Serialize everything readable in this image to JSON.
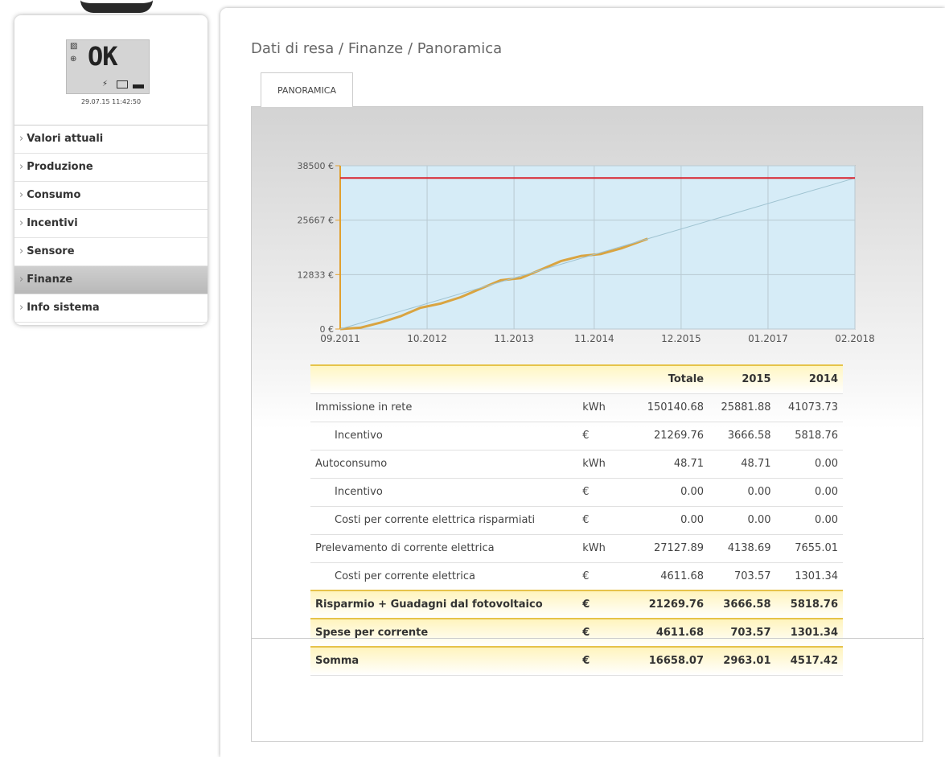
{
  "device": {
    "lcd_text": "OK",
    "datetime": "29.07.15 11:42:50"
  },
  "nav": [
    {
      "label": "Valori attuali",
      "active": false
    },
    {
      "label": "Produzione",
      "active": false
    },
    {
      "label": "Consumo",
      "active": false
    },
    {
      "label": "Incentivi",
      "active": false
    },
    {
      "label": "Sensore",
      "active": false
    },
    {
      "label": "Finanze",
      "active": true
    },
    {
      "label": "Info sistema",
      "active": false
    }
  ],
  "nav_caret": "›",
  "breadcrumb": "Dati di resa / Finanze / Panoramica",
  "tab_label": "PANORAMICA",
  "chart_data": {
    "type": "line",
    "ylim": [
      0,
      38500
    ],
    "y_ticks": [
      "0 €",
      "12833 €",
      "25667 €",
      "38500 €"
    ],
    "x_ticks": [
      "09.2011",
      "10.2012",
      "11.2013",
      "11.2014",
      "12.2015",
      "01.2017",
      "02.2018"
    ],
    "grid": true,
    "series": [
      {
        "color": "#d9a441",
        "x": [
          "09.2011",
          "12.2011",
          "03.2012",
          "06.2012",
          "09.2012",
          "12.2012",
          "03.2013",
          "06.2013",
          "09.2013",
          "12.2013",
          "03.2014",
          "06.2014",
          "09.2014",
          "12.2014",
          "03.2015",
          "07.2015"
        ],
        "values": [
          0,
          300,
          1500,
          3000,
          5000,
          6000,
          7500,
          9500,
          11500,
          12000,
          14000,
          16000,
          17200,
          17700,
          19000,
          21270
        ]
      },
      {
        "color": "#9fc3d1",
        "x": [
          "09.2011",
          "02.2018"
        ],
        "values": [
          0,
          35600
        ]
      },
      {
        "color": "#d9232e",
        "x": [
          "09.2011",
          "02.2018"
        ],
        "values": [
          35600,
          35600
        ]
      }
    ]
  },
  "table": {
    "headers": [
      "",
      "",
      "Totale",
      "2015",
      "2014"
    ],
    "rows": [
      {
        "label": "Immissione in rete",
        "unit": "kWh",
        "total": "150140.68",
        "y2015": "25881.88",
        "y2014": "41073.73",
        "indent": false
      },
      {
        "label": "Incentivo",
        "unit": "€",
        "total": "21269.76",
        "y2015": "3666.58",
        "y2014": "5818.76",
        "indent": true
      },
      {
        "label": "Autoconsumo",
        "unit": "kWh",
        "total": "48.71",
        "y2015": "48.71",
        "y2014": "0.00",
        "indent": false
      },
      {
        "label": "Incentivo",
        "unit": "€",
        "total": "0.00",
        "y2015": "0.00",
        "y2014": "0.00",
        "indent": true
      },
      {
        "label": "Costi per corrente elettrica risparmiati",
        "unit": "€",
        "total": "0.00",
        "y2015": "0.00",
        "y2014": "0.00",
        "indent": true
      },
      {
        "label": "Prelevamento di corrente elettrica",
        "unit": "kWh",
        "total": "27127.89",
        "y2015": "4138.69",
        "y2014": "7655.01",
        "indent": false
      },
      {
        "label": "Costi per corrente elettrica",
        "unit": "€",
        "total": "4611.68",
        "y2015": "703.57",
        "y2014": "1301.34",
        "indent": true
      }
    ],
    "summary": [
      {
        "label": "Risparmio + Guadagni dal fotovoltaico",
        "unit": "€",
        "total": "21269.76",
        "y2015": "3666.58",
        "y2014": "5818.76"
      },
      {
        "label": "Spese per corrente",
        "unit": "€",
        "total": "4611.68",
        "y2015": "703.57",
        "y2014": "1301.34"
      },
      {
        "label": "Somma",
        "unit": "€",
        "total": "16658.07",
        "y2015": "2963.01",
        "y2014": "4517.42"
      }
    ]
  }
}
